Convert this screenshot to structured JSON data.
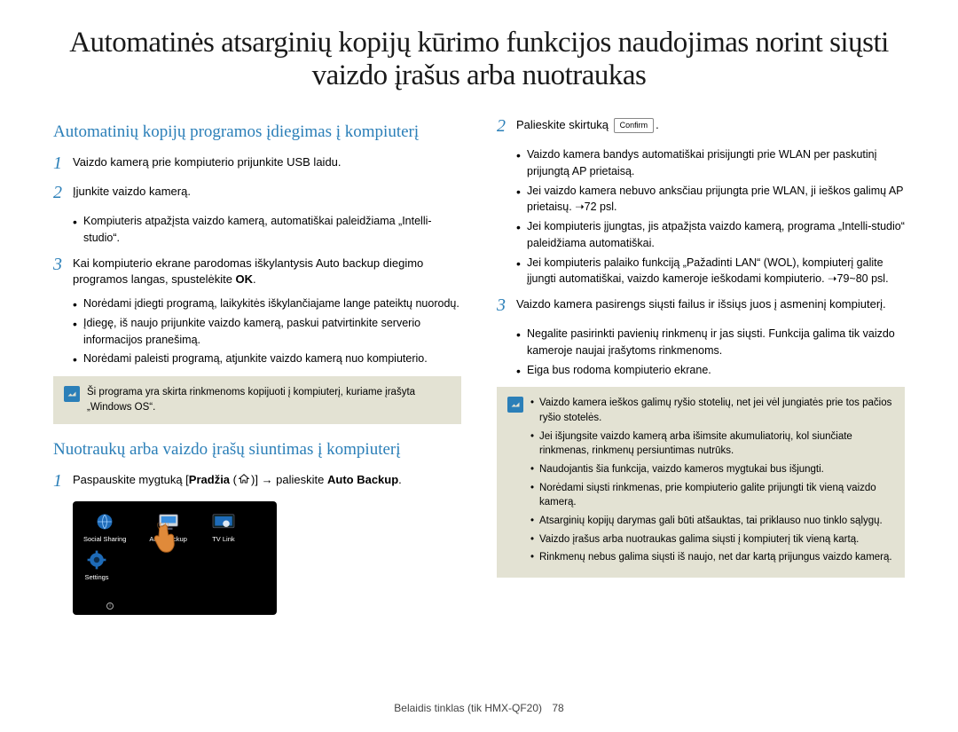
{
  "title": "Automatinės atsarginių kopijų kūrimo funkcijos naudojimas norint siųsti vaizdo įrašus arba nuotraukas",
  "left": {
    "heading1": "Automatinių kopijų programos įdiegimas į kompiuterį",
    "s1": "Vaizdo kamerą prie kompiuterio prijunkite USB laidu.",
    "s2": "Įjunkite vaizdo kamerą.",
    "s2_b1": "Kompiuteris atpažįsta vaizdo kamerą, automatiškai paleidžiama „Intelli-studio“.",
    "s3_a": "Kai kompiuterio ekrane parodomas iškylantysis Auto backup diegimo programos langas, spustelėkite ",
    "s3_ok": "OK",
    "s3_c": ".",
    "s3_b1": "Norėdami įdiegti programą, laikykitės iškylančiajame lange pateiktų nuorodų.",
    "s3_b2": "Įdiegę, iš naujo prijunkite vaizdo kamerą, paskui patvirtinkite serverio informacijos pranešimą.",
    "s3_b3": "Norėdami paleisti programą, atjunkite vaizdo kamerą nuo kompiuterio.",
    "note1": "Ši programa yra skirta rinkmenoms kopijuoti į kompiuterį, kuriame įrašyta „Windows OS“.",
    "heading2": "Nuotraukų arba vaizdo įrašų siuntimas į kompiuterį",
    "p1_a": "Paspauskite mygtuką [",
    "p1_b": "Pradžia",
    "p1_c": " (",
    "p1_d": ")] ",
    "p1_arrow": "→",
    "p1_e": " palieskite ",
    "p1_auto": "Auto Backup",
    "p1_f": ".",
    "device": {
      "i1": "Social Sharing",
      "i2": "Auto Backup",
      "i3": "TV Link",
      "i4": "Settings"
    }
  },
  "right": {
    "s2_a": "Palieskite skirtuką ",
    "s2_confirm": "Confirm",
    "s2_c": ".",
    "s2_b1": "Vaizdo kamera bandys automatiškai prisijungti prie WLAN per paskutinį prijungtą AP prietaisą.",
    "s2_b2": "Jei vaizdo kamera nebuvo anksčiau prijungta prie WLAN, ji ieškos galimų AP prietaisų. ➝72 psl.",
    "s2_b3": "Jei kompiuteris įjungtas, jis atpažįsta vaizdo kamerą, programa „Intelli-studio“ paleidžiama automatiškai.",
    "s2_b4": "Jei kompiuteris palaiko funkciją „Pažadinti LAN“ (WOL), kompiuterį galite įjungti automatiškai, vaizdo kameroje ieškodami kompiuterio. ➝79~80 psl.",
    "s3": "Vaizdo kamera pasirengs siųsti failus ir išsiųs juos į asmeninį kompiuterį.",
    "s3_b1": "Negalite pasirinkti pavienių rinkmenų ir jas siųsti. Funkcija galima tik vaizdo kameroje naujai įrašytoms rinkmenoms.",
    "s3_b2": "Eiga bus rodoma kompiuterio ekrane.",
    "note2": {
      "i1": "Vaizdo kamera ieškos galimų ryšio stotelių, net jei vėl jungiatės prie tos pačios ryšio stotelės.",
      "i2": "Jei išjungsite vaizdo kamerą arba išimsite akumuliatorių, kol siunčiate rinkmenas, rinkmenų persiuntimas nutrūks.",
      "i3": "Naudojantis šia funkcija, vaizdo kameros mygtukai bus išjungti.",
      "i4": "Norėdami siųsti rinkmenas, prie kompiuterio galite prijungti tik vieną vaizdo kamerą.",
      "i5": "Atsarginių kopijų darymas gali būti atšauktas, tai priklauso nuo tinklo sąlygų.",
      "i6": "Vaizdo įrašus arba nuotraukas galima siųsti į kompiuterį tik vieną kartą.",
      "i7": "Rinkmenų nebus galima siųsti iš naujo, net dar kartą prijungus vaizdo kamerą."
    }
  },
  "footer": {
    "section": "Belaidis tinklas (tik HMX-QF20)",
    "page": "78"
  }
}
